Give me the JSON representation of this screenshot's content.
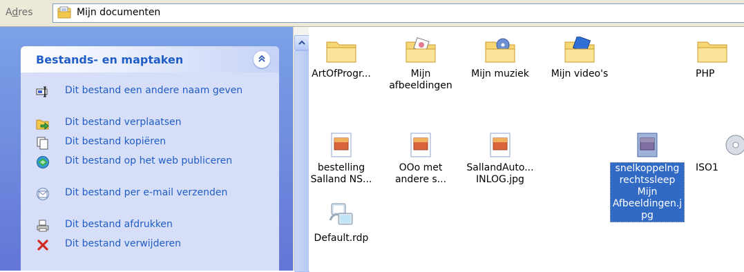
{
  "address_bar": {
    "label_prefix": "A",
    "label_underlined": "d",
    "label_suffix": "res",
    "location": "Mijn documenten"
  },
  "task_panel": {
    "title": "Bestands- en maptaken",
    "tasks": [
      {
        "label": "Dit bestand een andere naam geven",
        "icon": "rename-icon"
      },
      {
        "label": "Dit bestand verplaatsen",
        "icon": "move-icon"
      },
      {
        "label": "Dit bestand kopiëren",
        "icon": "copy-icon"
      },
      {
        "label": "Dit bestand op het web publiceren",
        "icon": "publish-web-icon"
      },
      {
        "label": "Dit bestand per e-mail verzenden",
        "icon": "email-icon"
      },
      {
        "label": "Dit bestand afdrukken",
        "icon": "print-icon"
      },
      {
        "label": "Dit bestand verwijderen",
        "icon": "delete-icon"
      }
    ]
  },
  "files": [
    {
      "name": "ArtOfProgr...",
      "type": "folder"
    },
    {
      "name": "Mijn\nafbeeldingen",
      "type": "folder-pictures"
    },
    {
      "name": "Mijn muziek",
      "type": "folder-music"
    },
    {
      "name": "Mijn video's",
      "type": "folder-videos"
    },
    {
      "name": "PHP",
      "type": "folder"
    },
    {
      "name": "bestelling\nSalland NS...",
      "type": "image"
    },
    {
      "name": "OOo met\nandere s...",
      "type": "image"
    },
    {
      "name": "SallandAuto...\nINLOG.jpg",
      "type": "image"
    },
    {
      "name": "snelkoppelng\nrechtssleep\nMijn\nAfbeeldingen.j\npg",
      "type": "image",
      "selected": true
    },
    {
      "name": "ISO1",
      "type": "disc"
    },
    {
      "name": "Default.rdp",
      "type": "rdp"
    }
  ],
  "colors": {
    "taskpane_gradient_top": "#7ba2e7",
    "taskpane_gradient_bottom": "#6375d6",
    "panel_title": "#215dc6",
    "selection": "#316ac5"
  }
}
